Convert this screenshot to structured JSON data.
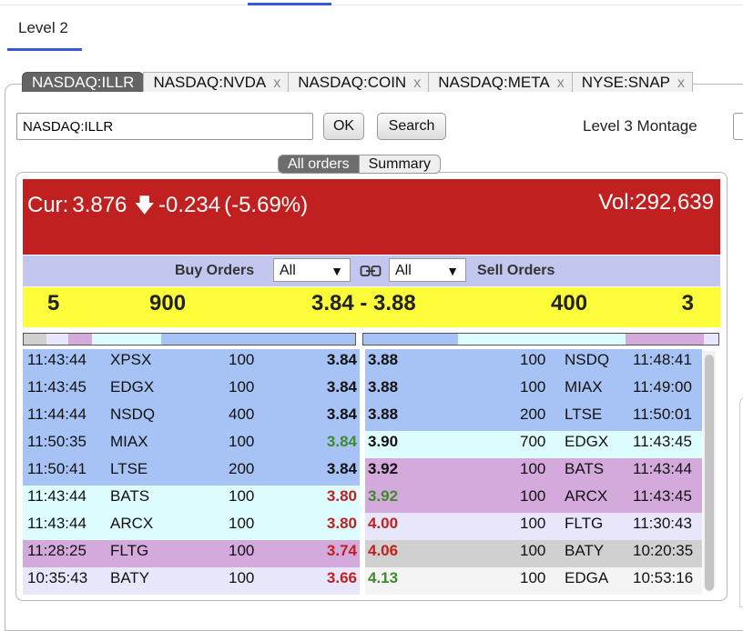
{
  "page_tab": {
    "label": "Level 2"
  },
  "symbol_tabs": [
    {
      "label": "NASDAQ:ILLR",
      "active": true,
      "close": ""
    },
    {
      "label": "NASDAQ:NVDA",
      "active": false,
      "close": "x"
    },
    {
      "label": "NASDAQ:COIN",
      "active": false,
      "close": "x"
    },
    {
      "label": "NASDAQ:META",
      "active": false,
      "close": "x"
    },
    {
      "label": "NYSE:SNAP",
      "active": false,
      "close": "x"
    }
  ],
  "controls": {
    "symbol_value": "NASDAQ:ILLR",
    "ok_label": "OK",
    "search_label": "Search",
    "montage_label": "Level 3 Montage"
  },
  "view_toggle": {
    "all_orders": "All orders",
    "summary": "Summary"
  },
  "quote": {
    "cur_label": "Cur:",
    "price": "3.876",
    "arrow_icon": "arrow-down-icon",
    "change": "-0.234",
    "change_pct": "(-5.69%)",
    "vol_label": "Vol:",
    "volume": "292,639"
  },
  "filters": {
    "buy_label": "Buy Orders",
    "buy_value": "All",
    "sell_label": "Sell Orders",
    "sell_value": "All"
  },
  "inside": {
    "bid_count": "5",
    "bid_size": "900",
    "spread": "3.84 - 3.88",
    "ask_size": "400",
    "ask_count": "3"
  },
  "colors": {
    "header_red": "#c0201f",
    "filter_bar": "#c3c6ee",
    "inside_yellow": "#fcfc3a",
    "level1_blue": "#a7c3f5",
    "level2_cyan": "#dcfcfd",
    "level3_purple": "#d4a9dc",
    "level4_lavender": "#e7e6fb",
    "level5_gray": "#d0d0d0",
    "level6_white": "#f4f4f4",
    "price_up_green": "#3e8a2c",
    "price_down_red": "#c0201f"
  },
  "buy_levels_bar": [
    "#d0d0d0",
    "#e7e6fb",
    "#d4a9dc",
    "#dcfcfd",
    "#dcfcfd",
    "#a7c3f5"
  ],
  "sell_levels_bar": [
    "#a7c3f5",
    "#dcfcfd",
    "#dcfcfd",
    "#d4a9dc",
    "#e7e6fb"
  ],
  "buy_orders": [
    {
      "time": "11:43:44",
      "mm": "XPSX",
      "size": "100",
      "price": "3.84",
      "bg": "#a7c3f5",
      "pc": "#111"
    },
    {
      "time": "11:43:45",
      "mm": "EDGX",
      "size": "100",
      "price": "3.84",
      "bg": "#a7c3f5",
      "pc": "#111"
    },
    {
      "time": "11:44:44",
      "mm": "NSDQ",
      "size": "400",
      "price": "3.84",
      "bg": "#a7c3f5",
      "pc": "#111"
    },
    {
      "time": "11:50:35",
      "mm": "MIAX",
      "size": "100",
      "price": "3.84",
      "bg": "#a7c3f5",
      "pc": "#3e8a2c"
    },
    {
      "time": "11:50:41",
      "mm": "LTSE",
      "size": "200",
      "price": "3.84",
      "bg": "#a7c3f5",
      "pc": "#111"
    },
    {
      "time": "11:43:44",
      "mm": "BATS",
      "size": "100",
      "price": "3.80",
      "bg": "#dcfcfd",
      "pc": "#c0201f"
    },
    {
      "time": "11:43:44",
      "mm": "ARCX",
      "size": "100",
      "price": "3.80",
      "bg": "#dcfcfd",
      "pc": "#c0201f"
    },
    {
      "time": "11:28:25",
      "mm": "FLTG",
      "size": "100",
      "price": "3.74",
      "bg": "#d4a9dc",
      "pc": "#c0201f"
    },
    {
      "time": "10:35:43",
      "mm": "BATY",
      "size": "100",
      "price": "3.66",
      "bg": "#e7e6fb",
      "pc": "#c0201f"
    }
  ],
  "sell_orders": [
    {
      "price": "3.88",
      "size": "100",
      "mm": "NSDQ",
      "time": "11:48:41",
      "bg": "#a7c3f5",
      "pc": "#111"
    },
    {
      "price": "3.88",
      "size": "100",
      "mm": "MIAX",
      "time": "11:49:00",
      "bg": "#a7c3f5",
      "pc": "#111"
    },
    {
      "price": "3.88",
      "size": "200",
      "mm": "LTSE",
      "time": "11:50:01",
      "bg": "#a7c3f5",
      "pc": "#111"
    },
    {
      "price": "3.90",
      "size": "700",
      "mm": "EDGX",
      "time": "11:43:45",
      "bg": "#dcfcfd",
      "pc": "#111"
    },
    {
      "price": "3.92",
      "size": "100",
      "mm": "BATS",
      "time": "11:43:44",
      "bg": "#d4a9dc",
      "pc": "#111"
    },
    {
      "price": "3.92",
      "size": "100",
      "mm": "ARCX",
      "time": "11:43:45",
      "bg": "#d4a9dc",
      "pc": "#3e8a2c"
    },
    {
      "price": "4.00",
      "size": "100",
      "mm": "FLTG",
      "time": "11:30:43",
      "bg": "#e7e6fb",
      "pc": "#c0201f"
    },
    {
      "price": "4.06",
      "size": "100",
      "mm": "BATY",
      "time": "10:20:35",
      "bg": "#d0d0d0",
      "pc": "#c0201f"
    },
    {
      "price": "4.13",
      "size": "100",
      "mm": "EDGA",
      "time": "10:53:16",
      "bg": "#f4f4f4",
      "pc": "#3e8a2c"
    }
  ]
}
